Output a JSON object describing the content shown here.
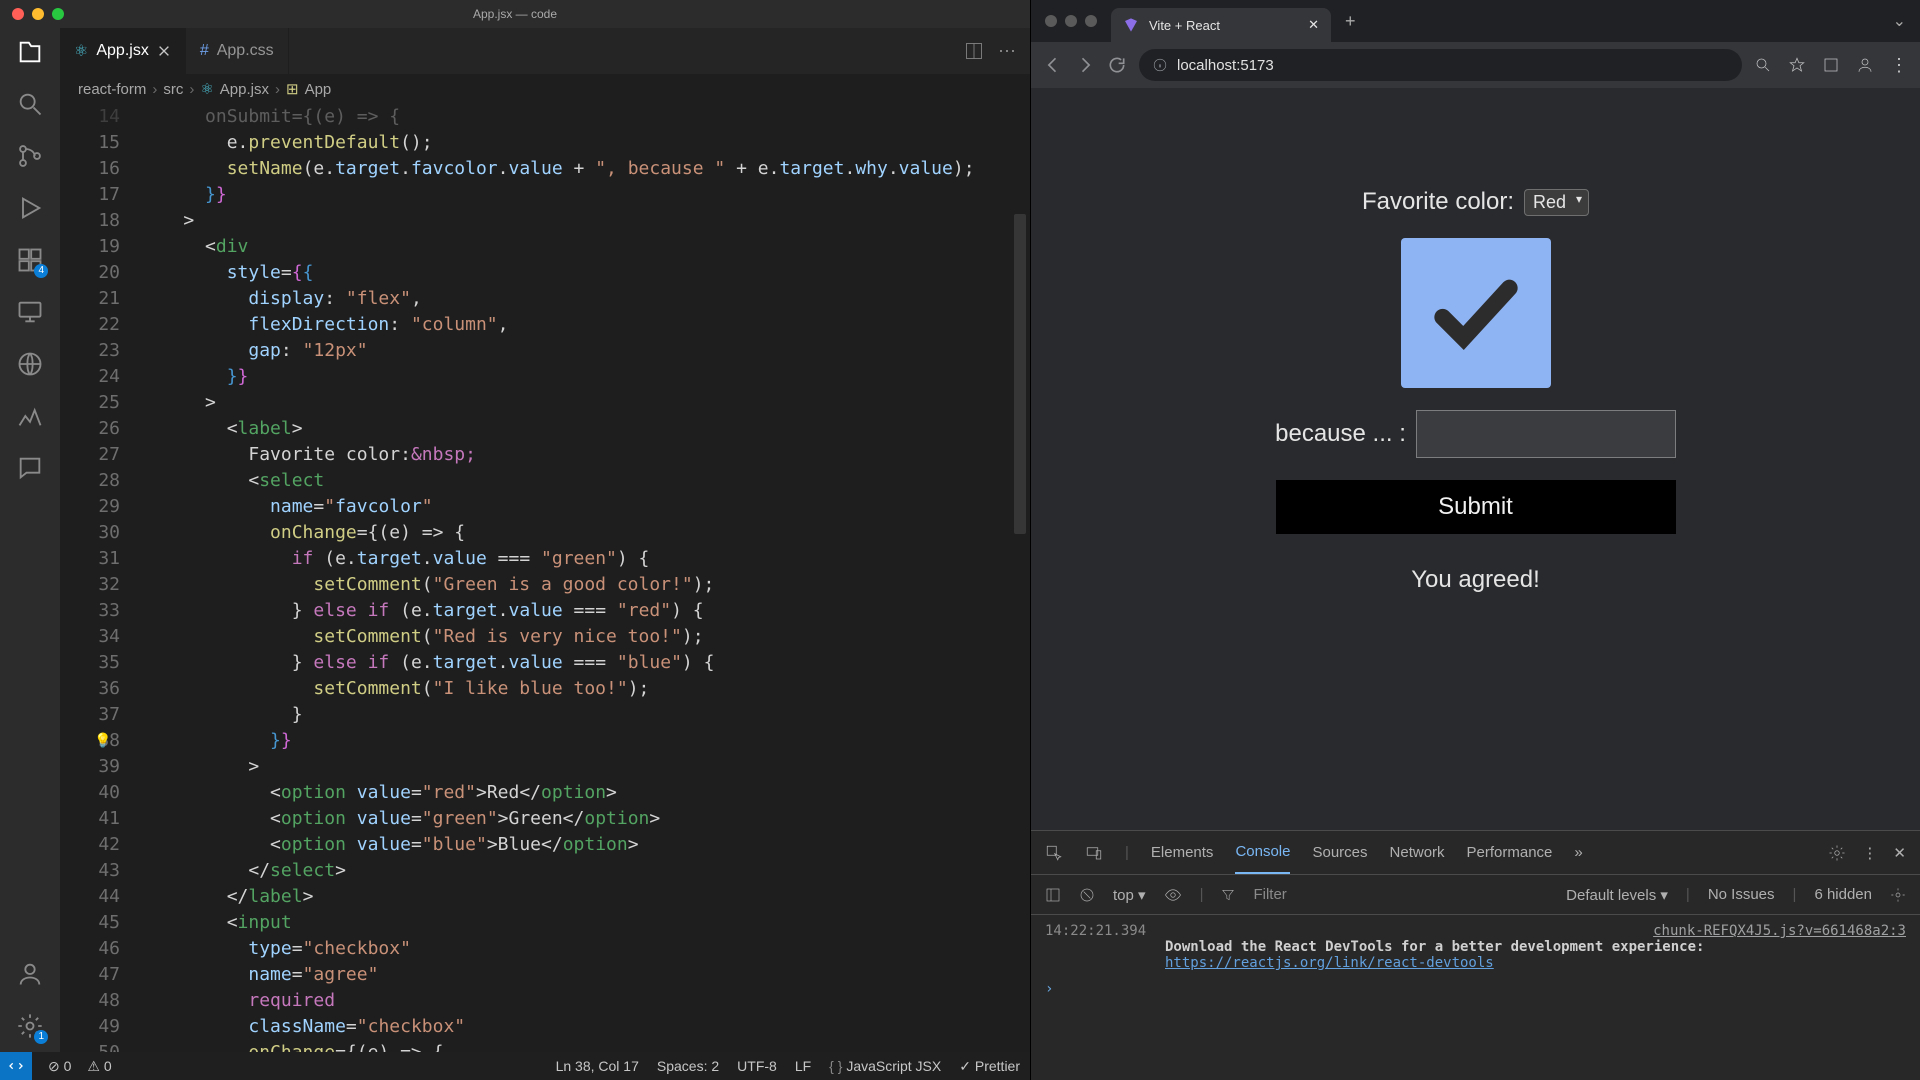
{
  "vscode": {
    "title": "App.jsx — code",
    "activity_badges": {
      "extensions": "4",
      "settings": "1"
    },
    "tabs": [
      {
        "label": "App.jsx",
        "active": true
      },
      {
        "label": "App.css",
        "active": false
      }
    ],
    "breadcrumb": {
      "folder": "react-form",
      "src": "src",
      "file": "App.jsx",
      "symbol": "App"
    },
    "line_start": 15,
    "bulb_line": 38,
    "code_lines": [
      "        e.preventDefault();",
      "        setName(e.target.favcolor.value + \", because \" + e.target.why.value);",
      "      }}",
      "    >",
      "      <div",
      "        style={{",
      "          display: \"flex\",",
      "          flexDirection: \"column\",",
      "          gap: \"12px\"",
      "        }}",
      "      >",
      "        <label>",
      "          Favorite color:&nbsp;",
      "          <select",
      "            name=\"favcolor\"",
      "            onChange={(e) => {",
      "              if (e.target.value === \"green\") {",
      "                setComment(\"Green is a good color!\");",
      "              } else if (e.target.value === \"red\") {",
      "                setComment(\"Red is very nice too!\");",
      "              } else if (e.target.value === \"blue\") {",
      "                setComment(\"I like blue too!\");",
      "              }",
      "            }}",
      "          >",
      "            <option value=\"red\">Red</option>",
      "            <option value=\"green\">Green</option>",
      "            <option value=\"blue\">Blue</option>",
      "          </select>",
      "        </label>",
      "        <input",
      "          type=\"checkbox\"",
      "          name=\"agree\"",
      "          required",
      "          className=\"checkbox\"",
      "          onChange={(e) => {"
    ],
    "statusbar": {
      "errors": "0",
      "warnings": "0",
      "position": "Ln 38, Col 17",
      "spaces": "Spaces: 2",
      "encoding": "UTF-8",
      "eol": "LF",
      "lang": "JavaScript JSX",
      "formatter": "Prettier"
    }
  },
  "browser": {
    "tab_title": "Vite + React",
    "url": "localhost:5173",
    "page": {
      "favorite_label": "Favorite color:",
      "select_value": "Red",
      "because_label": "because ... :",
      "submit": "Submit",
      "agree_msg": "You agreed!"
    }
  },
  "devtools": {
    "tabs": [
      "Elements",
      "Console",
      "Sources",
      "Network",
      "Performance"
    ],
    "active_tab": "Console",
    "more": "»",
    "top": "top",
    "filter_placeholder": "Filter",
    "levels": "Default levels",
    "no_issues": "No Issues",
    "hidden": "6 hidden",
    "log": {
      "time": "14:22:21.394",
      "file": "chunk-REFQX4J5.js?v=661468a2:3",
      "message": "Download the React DevTools for a better development experience:",
      "url": "https://reactjs.org/link/react-devtools"
    }
  }
}
